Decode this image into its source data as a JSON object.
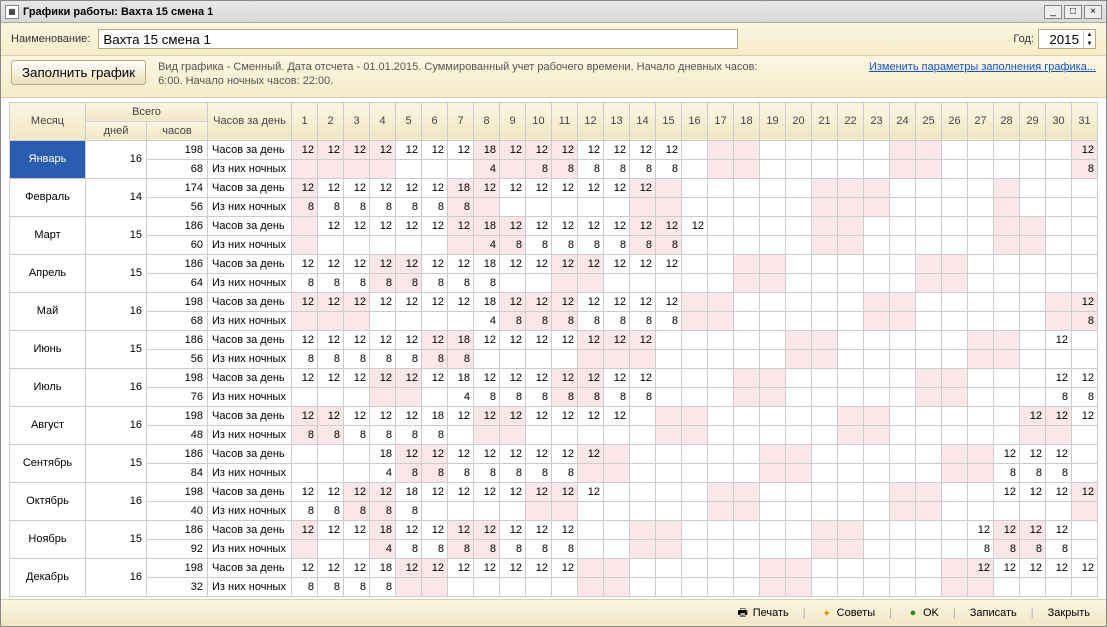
{
  "title": "Графики работы: Вахта 15 смена 1",
  "labels": {
    "name": "Наименование:",
    "year": "Год:",
    "fill": "Заполнить график",
    "info": "Вид графика - Сменный. Дата отсчета - 01.01.2015. Суммированный учет рабочего времени. Начало дневных часов: 6:00. Начало ночных часов: 22:00.",
    "link": "Изменить параметры заполнения графика...",
    "month": "Месяц",
    "total": "Всего",
    "hpd": "Часов за день",
    "days": "дней",
    "hours": "часов",
    "row_day": "Часов за день",
    "row_night": "Из них ночных",
    "print": "Печать",
    "tips": "Советы",
    "ok": "OK",
    "save": "Записать",
    "close": "Закрыть"
  },
  "name_value": "Вахта 15 смена 1",
  "year_value": "2015",
  "day_headers": [
    "1",
    "2",
    "3",
    "4",
    "5",
    "6",
    "7",
    "8",
    "9",
    "10",
    "11",
    "12",
    "13",
    "14",
    "15",
    "16",
    "17",
    "18",
    "19",
    "20",
    "21",
    "22",
    "23",
    "24",
    "25",
    "26",
    "27",
    "28",
    "29",
    "30",
    "31"
  ],
  "chart_data": {
    "type": "table",
    "pink_days": {
      "Январь": [
        1,
        2,
        3,
        4,
        8,
        9,
        10,
        11,
        17,
        18,
        24,
        25,
        31
      ],
      "Февраль": [
        1,
        7,
        8,
        14,
        15,
        21,
        22,
        23,
        28
      ],
      "Март": [
        1,
        7,
        8,
        9,
        14,
        15,
        21,
        22,
        28,
        29
      ],
      "Апрель": [
        4,
        5,
        11,
        12,
        18,
        19,
        25,
        26
      ],
      "Май": [
        1,
        2,
        3,
        9,
        10,
        11,
        16,
        17,
        23,
        24,
        30,
        31
      ],
      "Июнь": [
        6,
        7,
        12,
        13,
        14,
        20,
        21,
        27,
        28
      ],
      "Июль": [
        4,
        5,
        11,
        12,
        18,
        19,
        25,
        26
      ],
      "Август": [
        1,
        2,
        8,
        9,
        15,
        16,
        22,
        23,
        29,
        30
      ],
      "Сентябрь": [
        5,
        6,
        12,
        13,
        19,
        20,
        26,
        27
      ],
      "Октябрь": [
        3,
        4,
        10,
        11,
        17,
        18,
        24,
        25,
        31
      ],
      "Ноябрь": [
        1,
        4,
        7,
        8,
        14,
        15,
        21,
        22,
        28,
        29
      ],
      "Декабрь": [
        5,
        6,
        12,
        13,
        19,
        20,
        26,
        27
      ]
    },
    "months": [
      {
        "name": "Январь",
        "days": 16,
        "hours": 198,
        "night": 68,
        "day_vals": {
          "1": 12,
          "2": 12,
          "3": 12,
          "4": 12,
          "5": 12,
          "6": 12,
          "7": 12,
          "8": 18,
          "9": 12,
          "10": 12,
          "11": 12,
          "12": 12,
          "13": 12,
          "14": 12,
          "15": 12,
          "31": 12
        },
        "night_vals": {
          "8": 4,
          "10": 8,
          "11": 8,
          "12": 8,
          "13": 8,
          "14": 8,
          "15": 8,
          "31": 8
        }
      },
      {
        "name": "Февраль",
        "days": 14,
        "hours": 174,
        "night": 56,
        "day_vals": {
          "1": 12,
          "2": 12,
          "3": 12,
          "4": 12,
          "5": 12,
          "6": 12,
          "7": 18,
          "8": 12,
          "9": 12,
          "10": 12,
          "11": 12,
          "12": 12,
          "13": 12,
          "14": 12
        },
        "night_vals": {
          "1": 8,
          "2": 8,
          "3": 8,
          "4": 8,
          "5": 8,
          "6": 8,
          "7": 8
        }
      },
      {
        "name": "Март",
        "days": 15,
        "hours": 186,
        "night": 60,
        "day_vals": {
          "2": 12,
          "3": 12,
          "4": 12,
          "5": 12,
          "6": 12,
          "7": 12,
          "8": 18,
          "9": 12,
          "10": 12,
          "11": 12,
          "12": 12,
          "13": 12,
          "14": 12,
          "15": 12,
          "16": 12
        },
        "night_vals": {
          "8": 4,
          "9": 8,
          "10": 8,
          "11": 8,
          "12": 8,
          "13": 8,
          "14": 8,
          "15": 8
        }
      },
      {
        "name": "Апрель",
        "days": 15,
        "hours": 186,
        "night": 64,
        "day_vals": {
          "1": 12,
          "2": 12,
          "3": 12,
          "4": 12,
          "5": 12,
          "6": 12,
          "7": 12,
          "8": 18,
          "9": 12,
          "10": 12,
          "11": 12,
          "12": 12,
          "13": 12,
          "14": 12,
          "15": 12
        },
        "night_vals": {
          "1": 8,
          "2": 8,
          "3": 8,
          "4": 8,
          "5": 8,
          "6": 8,
          "7": 8,
          "8": 8
        }
      },
      {
        "name": "Май",
        "days": 16,
        "hours": 198,
        "night": 68,
        "day_vals": {
          "1": 12,
          "2": 12,
          "3": 12,
          "4": 12,
          "5": 12,
          "6": 12,
          "7": 12,
          "8": 18,
          "9": 12,
          "10": 12,
          "11": 12,
          "12": 12,
          "13": 12,
          "14": 12,
          "15": 12,
          "31": 12
        },
        "night_vals": {
          "8": 4,
          "9": 8,
          "10": 8,
          "11": 8,
          "12": 8,
          "13": 8,
          "14": 8,
          "15": 8,
          "31": 8
        }
      },
      {
        "name": "Июнь",
        "days": 15,
        "hours": 186,
        "night": 56,
        "day_vals": {
          "1": 12,
          "2": 12,
          "3": 12,
          "4": 12,
          "5": 12,
          "6": 12,
          "7": 18,
          "8": 12,
          "9": 12,
          "10": 12,
          "11": 12,
          "12": 12,
          "13": 12,
          "14": 12,
          "30": 12
        },
        "night_vals": {
          "1": 8,
          "2": 8,
          "3": 8,
          "4": 8,
          "5": 8,
          "6": 8,
          "7": 8
        }
      },
      {
        "name": "Июль",
        "days": 16,
        "hours": 198,
        "night": 76,
        "day_vals": {
          "1": 12,
          "2": 12,
          "3": 12,
          "4": 12,
          "5": 12,
          "6": 12,
          "7": 18,
          "8": 12,
          "9": 12,
          "10": 12,
          "11": 12,
          "12": 12,
          "13": 12,
          "14": 12,
          "30": 12,
          "31": 12
        },
        "night_vals": {
          "7": 4,
          "8": 8,
          "9": 8,
          "10": 8,
          "11": 8,
          "12": 8,
          "13": 8,
          "14": 8,
          "30": 8,
          "31": 8
        }
      },
      {
        "name": "Август",
        "days": 16,
        "hours": 198,
        "night": 48,
        "day_vals": {
          "1": 12,
          "2": 12,
          "3": 12,
          "4": 12,
          "5": 12,
          "6": 18,
          "7": 12,
          "8": 12,
          "9": 12,
          "10": 12,
          "11": 12,
          "12": 12,
          "13": 12,
          "29": 12,
          "30": 12,
          "31": 12
        },
        "night_vals": {
          "1": 8,
          "2": 8,
          "3": 8,
          "4": 8,
          "5": 8,
          "6": 8
        }
      },
      {
        "name": "Сентябрь",
        "days": 15,
        "hours": 186,
        "night": 84,
        "day_vals": {
          "4": 18,
          "5": 12,
          "6": 12,
          "7": 12,
          "8": 12,
          "9": 12,
          "10": 12,
          "11": 12,
          "12": 12,
          "28": 12,
          "29": 12,
          "30": 12
        },
        "night_vals": {
          "4": 4,
          "5": 8,
          "6": 8,
          "7": 8,
          "8": 8,
          "9": 8,
          "10": 8,
          "11": 8,
          "28": 8,
          "29": 8,
          "30": 8
        }
      },
      {
        "name": "Октябрь",
        "days": 16,
        "hours": 198,
        "night": 40,
        "day_vals": {
          "1": 12,
          "2": 12,
          "3": 12,
          "4": 12,
          "5": 18,
          "6": 12,
          "7": 12,
          "8": 12,
          "9": 12,
          "10": 12,
          "11": 12,
          "12": 12,
          "28": 12,
          "29": 12,
          "30": 12,
          "31": 12
        },
        "night_vals": {
          "1": 8,
          "2": 8,
          "3": 8,
          "4": 8,
          "5": 8
        }
      },
      {
        "name": "Ноябрь",
        "days": 15,
        "hours": 186,
        "night": 92,
        "day_vals": {
          "1": 12,
          "2": 12,
          "3": 12,
          "4": 18,
          "5": 12,
          "6": 12,
          "7": 12,
          "8": 12,
          "9": 12,
          "10": 12,
          "11": 12,
          "27": 12,
          "28": 12,
          "29": 12,
          "30": 12
        },
        "night_vals": {
          "4": 4,
          "5": 8,
          "6": 8,
          "7": 8,
          "8": 8,
          "9": 8,
          "10": 8,
          "11": 8,
          "27": 8,
          "28": 8,
          "29": 8,
          "30": 8
        }
      },
      {
        "name": "Декабрь",
        "days": 16,
        "hours": 198,
        "night": 32,
        "day_vals": {
          "1": 12,
          "2": 12,
          "3": 12,
          "4": 18,
          "5": 12,
          "6": 12,
          "7": 12,
          "8": 12,
          "9": 12,
          "10": 12,
          "11": 12,
          "27": 12,
          "28": 12,
          "29": 12,
          "30": 12,
          "31": 12
        },
        "night_vals": {
          "1": 8,
          "2": 8,
          "3": 8,
          "4": 8
        }
      }
    ]
  }
}
